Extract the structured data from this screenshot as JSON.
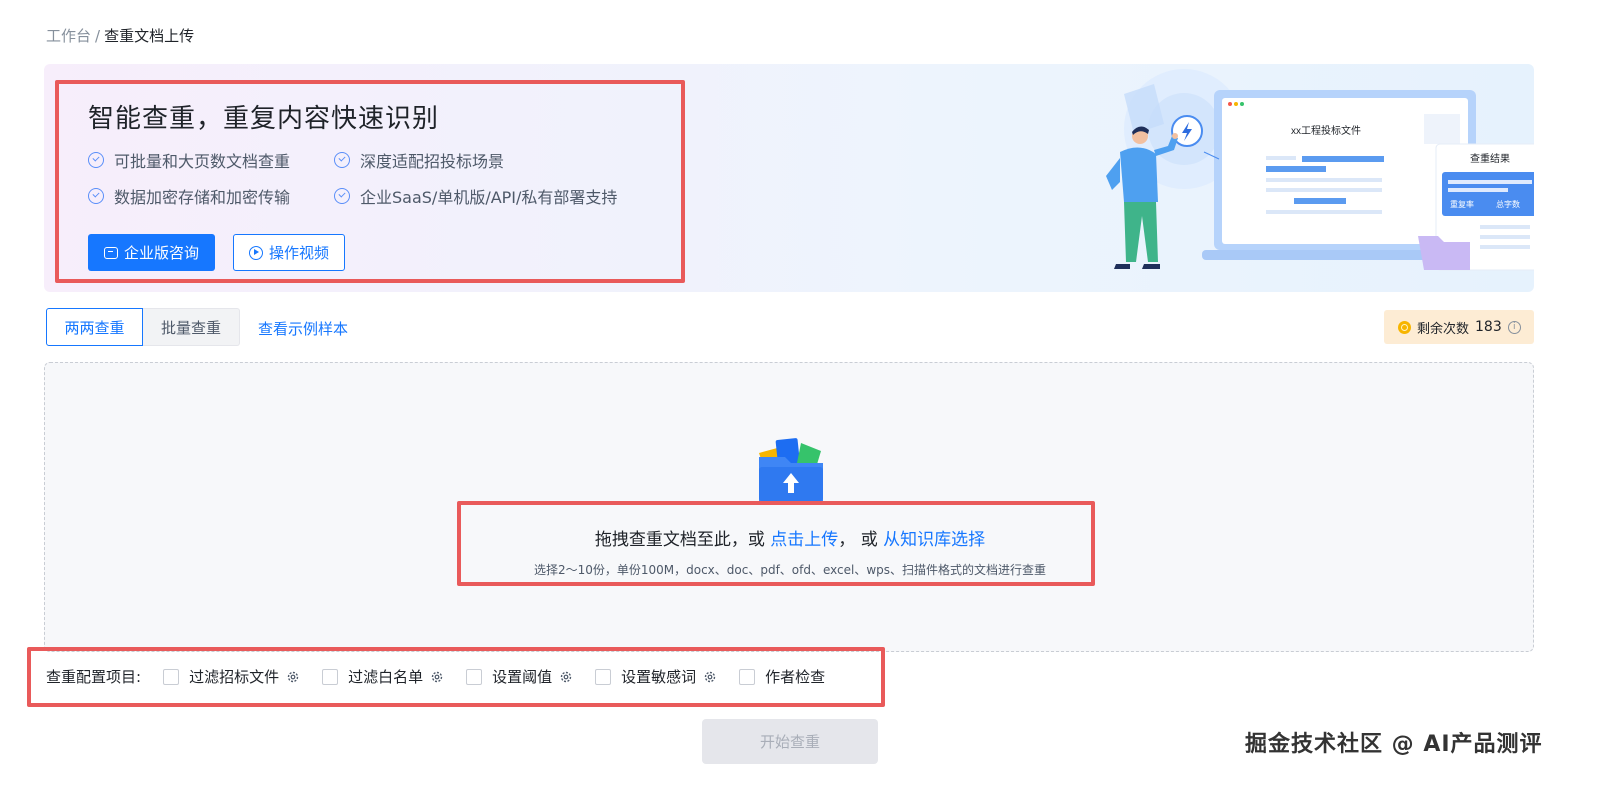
{
  "breadcrumb": {
    "root": "工作台",
    "separator": "/",
    "current": "查重文档上传"
  },
  "banner": {
    "title": "智能查重，重复内容快速识别",
    "features": [
      "可批量和大页数文档查重",
      "深度适配招投标场景",
      "数据加密存储和加密传输",
      "企业SaaS/单机版/API/私有部署支持"
    ],
    "enterprise_btn": "企业版咨询",
    "video_btn": "操作视频",
    "illustration": {
      "doc_title": "xx工程投标文件",
      "result_title": "查重结果",
      "repeat_rate": "重复率",
      "total_words": "总字数"
    }
  },
  "tabs": [
    "两两查重",
    "批量查重"
  ],
  "sample_link": "查看示例样本",
  "remain": {
    "label": "剩余次数",
    "count": "183"
  },
  "upload": {
    "text_prefix": "拖拽查重文档至此，或",
    "click_upload": "点击上传",
    "text_mid": "，  或",
    "from_kb": "从知识库选择",
    "hint": "选择2～10份，单份100M，docx、doc、pdf、ofd、excel、wps、扫描件格式的文档进行查重"
  },
  "config": {
    "label": "查重配置项目:",
    "items": [
      {
        "label": "过滤招标文件",
        "gear": true
      },
      {
        "label": "过滤白名单",
        "gear": true
      },
      {
        "label": "设置阈值",
        "gear": true
      },
      {
        "label": "设置敏感词",
        "gear": true
      },
      {
        "label": "作者检查",
        "gear": false
      }
    ]
  },
  "start_btn": "开始查重",
  "watermark": "掘金技术社区 @ AI产品测评",
  "colors": {
    "primary": "#1677ff",
    "highlight_box": "#e95a5a",
    "remain_bg": "#fdecd4"
  }
}
